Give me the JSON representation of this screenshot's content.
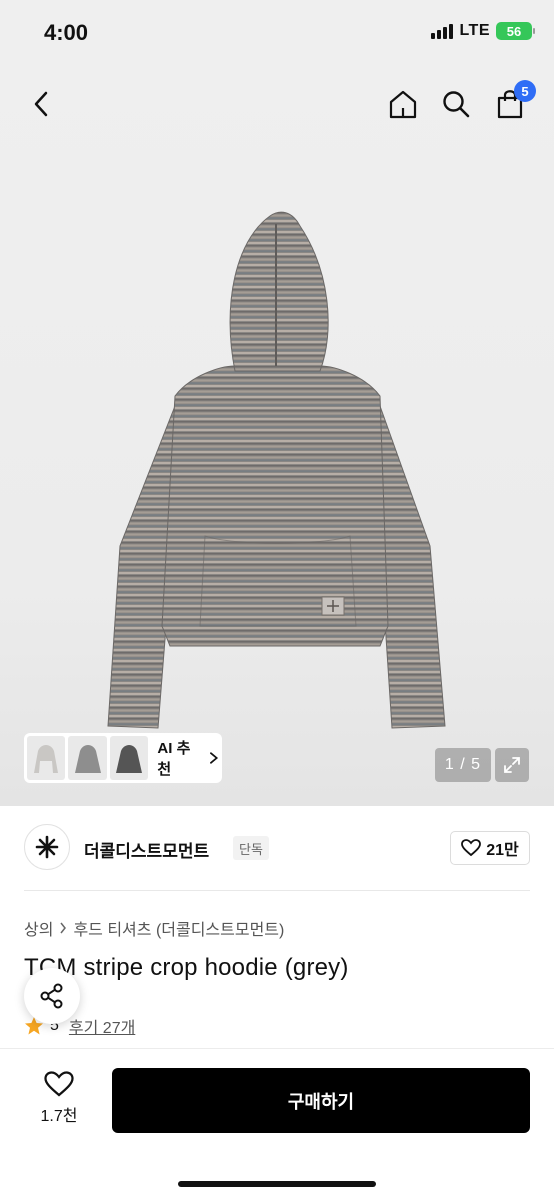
{
  "status_bar": {
    "time": "4:00",
    "network": "LTE",
    "battery": "56"
  },
  "nav": {
    "cart_count": "5"
  },
  "hero": {
    "ai_label": "AI 추천",
    "counter": "1 / 5"
  },
  "brand": {
    "name": "더콜디스트모먼트",
    "tag": "단독",
    "likes": "21만"
  },
  "breadcrumb": {
    "category": "상의",
    "subcategory": "후드 티셔츠 (더콜디스트모먼트)"
  },
  "product": {
    "title": "TCM stripe crop hoodie (grey)",
    "rating": "5",
    "reviews": "후기 27개"
  },
  "bottom": {
    "wish_count": "1.7천",
    "buy_label": "구매하기"
  },
  "colors": {
    "accent": "#2f6df6",
    "battery": "#35c759",
    "star": "#f6a623",
    "buy_button": "#000000"
  }
}
